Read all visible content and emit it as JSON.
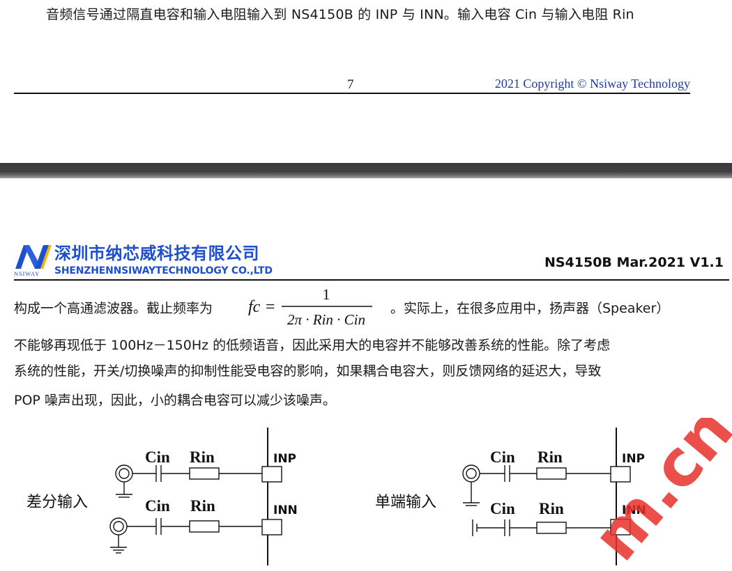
{
  "previous_page": {
    "last_line": "音频信号通过隔直电容和输入电阻输入到 NS4150B 的 INP 与  INN。输入电容 Cin 与输入电阻  Rin",
    "page_number": "7",
    "copyright": "2021 Copyright © Nsiway Technology"
  },
  "header": {
    "logo_text": "NSIWAY",
    "company_cn": "深圳市纳芯威科技有限公司",
    "company_en": "SHENZHENNSIWAYTECHNOLOGY CO.,LTD",
    "doc_version": "NS4150B Mar.2021 V1.1"
  },
  "body": {
    "line1_before": "构成一个高通滤波器。截止频率为",
    "formula": {
      "lhs": "fc =",
      "numerator": "1",
      "denominator": "2π · Rin · Cin"
    },
    "line1_after": "。实际上，在很多应用中，扬声器（Speaker）",
    "line2": "不能够再现低于 100Hz－150Hz 的低频语音，因此采用大的电容并不能够改善系统的性能。除了考虑",
    "line3": "系统的性能，开关/切换噪声的抑制性能受电容的影响，如果耦合电容大，则反馈网络的延迟大，导致",
    "line4": "POP 噪声出现，因此，小的耦合电容可以减少该噪声。"
  },
  "diagrams": {
    "differential": {
      "title": "差分输入",
      "cap_label": "Cin",
      "res_label": "Rin",
      "pin_positive": "INP",
      "pin_negative": "INN"
    },
    "single_ended": {
      "title": "单端输入",
      "cap_label": "Cin",
      "res_label": "Rin",
      "pin_positive": "INP",
      "pin_negative": "INN"
    }
  },
  "watermark": {
    "text": "m.cn",
    "color": "#e8302a"
  },
  "colors": {
    "brand_blue": "#1e4fcf",
    "copyright_blue": "#1f3a9c",
    "separator": "#3f4042"
  }
}
